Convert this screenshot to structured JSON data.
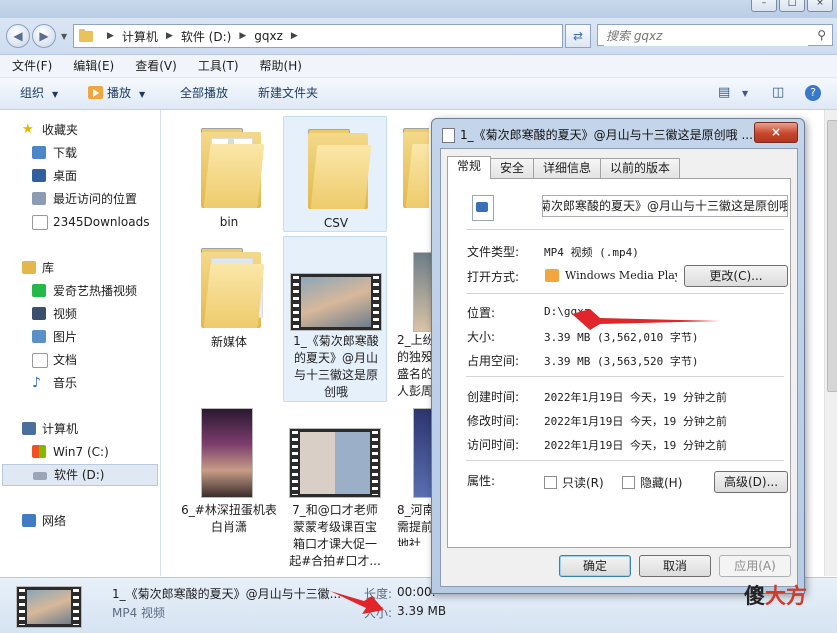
{
  "window_controls": [
    "–",
    "□",
    "×"
  ],
  "breadcrumb": [
    "计算机",
    "软件 (D:)",
    "gqxz"
  ],
  "search": {
    "placeholder": "搜索 gqxz"
  },
  "menu": [
    "文件(F)",
    "编辑(E)",
    "查看(V)",
    "工具(T)",
    "帮助(H)"
  ],
  "toolbar": {
    "organize": "组织",
    "play": "播放",
    "play_all": "全部播放",
    "new_folder": "新建文件夹"
  },
  "nav": {
    "favorites_header": "收藏夹",
    "favorites": [
      "下载",
      "桌面",
      "最近访问的位置",
      "2345Downloads"
    ],
    "libraries_header": "库",
    "libraries": [
      "爱奇艺热播视频",
      "视频",
      "图片",
      "文档",
      "音乐"
    ],
    "computer_header": "计算机",
    "drives": [
      "Win7 (C:)",
      "软件 (D:)"
    ],
    "network_header": "网络"
  },
  "files": [
    {
      "name": "bin"
    },
    {
      "name": "CSV"
    },
    {
      "name": "新媒体"
    },
    {
      "name": "1_《菊次郎寒酸的夏天》@月山与十三徽这是原创哦"
    },
    {
      "name": "2_上纷的独殁盛名的人彭周"
    },
    {
      "name": "6_#林深扭蛋机表白肖潇"
    },
    {
      "name": "7_和@口才老师蒙蒙考级课百宝箱口才课大促一起#合拍#口才..."
    },
    {
      "name": "8_河南需提前地社"
    }
  ],
  "file_labels": {
    "bin": [
      "bin"
    ],
    "csv": [
      "CSV"
    ],
    "xinmeiti": [
      "新媒体"
    ],
    "v1": [
      "1_《菊次郎寒酸",
      "的夏天》@月山",
      "与十三徽这是原",
      "创哦"
    ],
    "v2": [
      "2_上纷",
      "的独殁",
      "盛名的",
      "人彭周"
    ],
    "v6": [
      "6_#林深扭蛋机表",
      "白肖潇"
    ],
    "v7": [
      "7_和@口才老师",
      "蒙蒙考级课百宝",
      "箱口才课大促一",
      "起#合拍#口才..."
    ],
    "v8": [
      "8_河南",
      "需提前",
      "地社"
    ]
  },
  "details_pane": {
    "name": "1_《菊次郎寒酸的夏天》@月山与十三徽...",
    "type": "MP4 视频",
    "duration_label": "长度:",
    "duration_value": "00:00:",
    "size_label": "大小:",
    "size_value": "3.39 MB"
  },
  "dialog": {
    "title": "1_《菊次郎寒酸的夏天》@月山与十三徽这是原创哦 ...",
    "close": "×",
    "tabs": [
      "常规",
      "安全",
      "详细信息",
      "以前的版本"
    ],
    "filename": "菊次郎寒酸的夏天》@月山与十三徽这是原创哦",
    "type_label": "文件类型:",
    "type_value": "MP4 视频 (.mp4)",
    "opens_label": "打开方式:",
    "opens_value": "Windows Media Playe",
    "change_button": "更改(C)...",
    "location_label": "位置:",
    "location_value": "D:\\gqxz",
    "size_label": "大小:",
    "size_value": "3.39 MB (3,562,010 字节)",
    "disk_label": "占用空间:",
    "disk_value": "3.39 MB (3,563,520 字节)",
    "created_label": "创建时间:",
    "created_value": "2022年1月19日 今天，19 分钟之前",
    "modified_label": "修改时间:",
    "modified_value": "2022年1月19日 今天，19 分钟之前",
    "accessed_label": "访问时间:",
    "accessed_value": "2022年1月19日 今天，19 分钟之前",
    "attributes_label": "属性:",
    "readonly": "只读(R)",
    "hidden": "隐藏(H)",
    "advanced_button": "高级(D)...",
    "ok": "确定",
    "cancel": "取消",
    "apply": "应用(A)"
  },
  "watermark": {
    "dark": "傻",
    "rest": "大方"
  },
  "colors": {
    "accent_red": "#e0262a",
    "selection": "#e0e8f3",
    "close_red": "#c7462c"
  }
}
